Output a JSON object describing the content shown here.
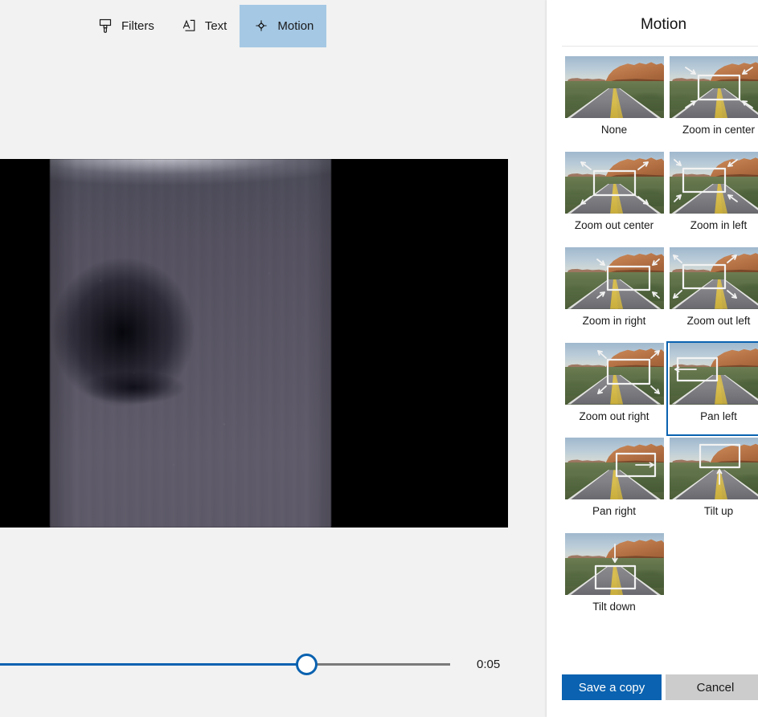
{
  "toolbar": {
    "items": [
      {
        "label": "Filters",
        "icon": "brush-icon",
        "selected": false
      },
      {
        "label": "Text",
        "icon": "text-box-icon",
        "selected": false
      },
      {
        "label": "Motion",
        "icon": "move-icon",
        "selected": true
      }
    ]
  },
  "player": {
    "time": "0:05",
    "progress_percent": 68
  },
  "panel": {
    "title": "Motion",
    "selected_effect": "Pan left",
    "effects": [
      {
        "label": "None",
        "overlay": "none"
      },
      {
        "label": "Zoom in center",
        "overlay": "zoom-in-center"
      },
      {
        "label": "Zoom out center",
        "overlay": "zoom-out-center"
      },
      {
        "label": "Zoom in left",
        "overlay": "zoom-in-left"
      },
      {
        "label": "Zoom in right",
        "overlay": "zoom-in-right"
      },
      {
        "label": "Zoom out left",
        "overlay": "zoom-out-left"
      },
      {
        "label": "Zoom out right",
        "overlay": "zoom-out-right"
      },
      {
        "label": "Pan left",
        "overlay": "pan-left"
      },
      {
        "label": "Pan right",
        "overlay": "pan-right"
      },
      {
        "label": "Tilt up",
        "overlay": "tilt-up"
      },
      {
        "label": "Tilt down",
        "overlay": "tilt-down"
      }
    ],
    "save_label": "Save a copy",
    "cancel_label": "Cancel"
  },
  "colors": {
    "accent": "#0a62b0",
    "selected_tool_bg": "#a5c8e4",
    "panel_bg": "#ffffff",
    "app_bg": "#f2f2f2",
    "cancel_bg": "#cccccc"
  }
}
